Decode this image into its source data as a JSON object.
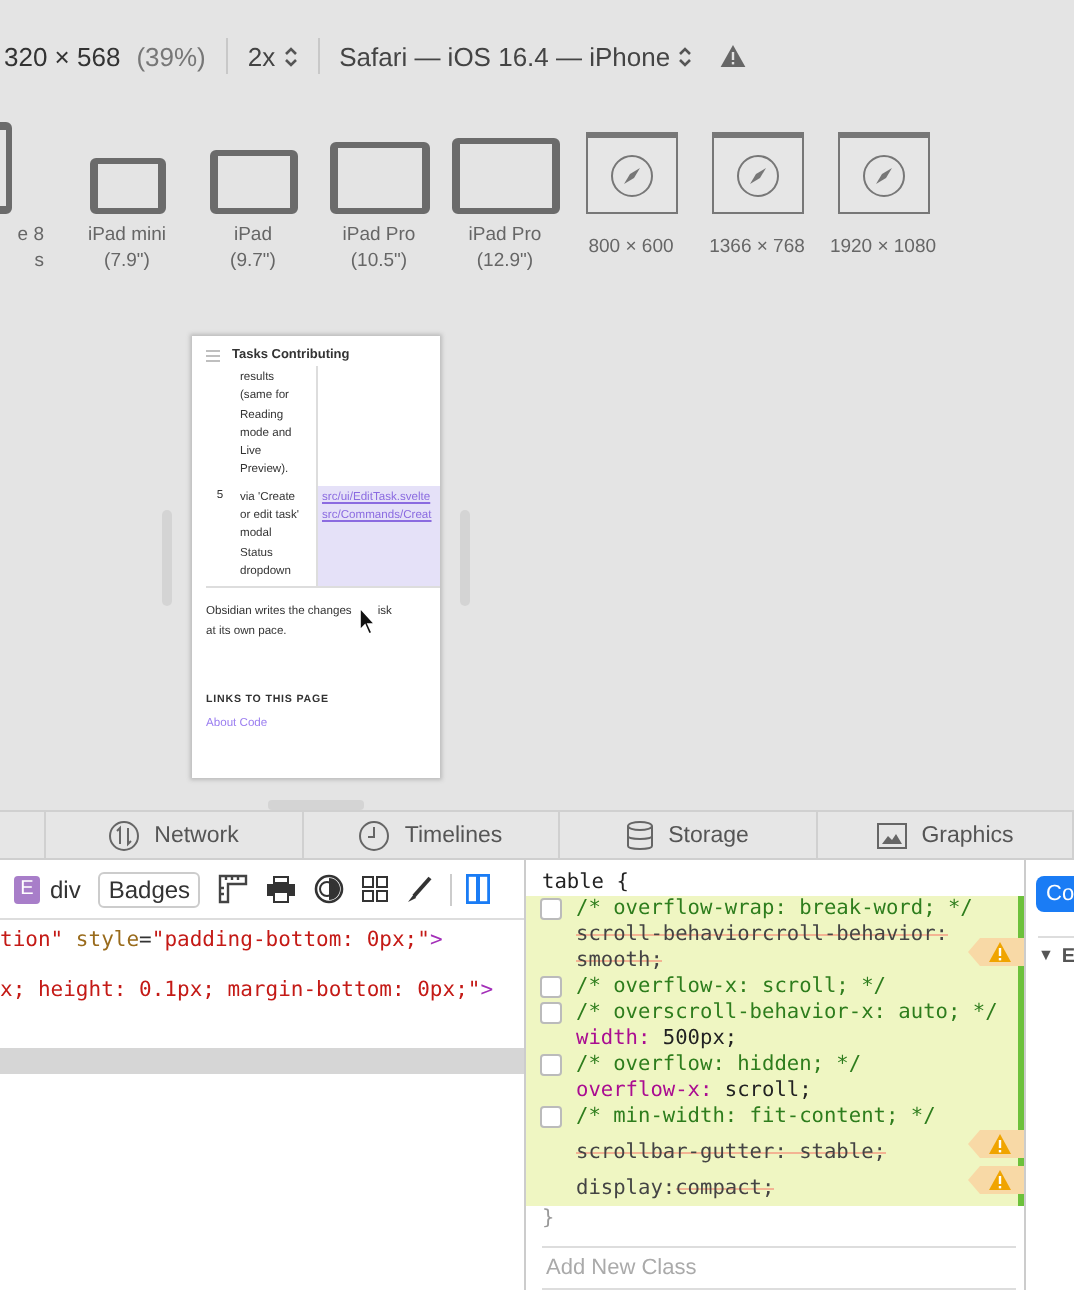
{
  "toolbar": {
    "dimensions": "320 × 568",
    "zoom": "(39%)",
    "scale": "2x",
    "browser": "Safari — iOS 16.4 — iPhone"
  },
  "devices": [
    {
      "kind": "phone",
      "label": [
        "e 8",
        "s"
      ]
    },
    {
      "kind": "ipad-mini",
      "label": [
        "iPad mini",
        "(7.9\")"
      ]
    },
    {
      "kind": "ipad",
      "label": [
        "iPad",
        "(9.7\")"
      ]
    },
    {
      "kind": "ipad-pro-10",
      "label": [
        "iPad Pro",
        "(10.5\")"
      ]
    },
    {
      "kind": "ipad-pro-12",
      "label": [
        "iPad Pro",
        "(12.9\")"
      ]
    },
    {
      "kind": "window",
      "label": [
        "800 × 600"
      ]
    },
    {
      "kind": "window",
      "label": [
        "1366 × 768"
      ]
    },
    {
      "kind": "window",
      "label": [
        "1920 × 1080"
      ]
    }
  ],
  "preview": {
    "title": "Tasks Contributing",
    "rows": [
      {
        "number": "",
        "lines": [
          "results",
          "(same for",
          "Reading",
          "mode and",
          "Live",
          "Preview)."
        ],
        "links": [],
        "highlighted": false
      },
      {
        "number": "5",
        "lines": [
          "via 'Create",
          "or edit task'",
          "modal",
          "Status",
          "dropdown"
        ],
        "links": [
          "src/ui/EditTask.svelte",
          "src/Commands/Creat"
        ],
        "highlighted": true
      }
    ],
    "paragraph": [
      "Obsidian writes the changes",
      "isk",
      "at its own pace."
    ],
    "links_heading": "LINKS TO THIS PAGE",
    "links": [
      "About Code"
    ]
  },
  "tabs": [
    {
      "label": "Network",
      "kind": "network",
      "selected": false
    },
    {
      "label": "Timelines",
      "kind": "timelines",
      "selected": false
    },
    {
      "label": "Storage",
      "kind": "storage",
      "selected": false
    },
    {
      "label": "Graphics",
      "kind": "graphics",
      "selected": false
    }
  ],
  "dom": {
    "element_badge": "E",
    "element": "div",
    "badges_button": "Badges",
    "lines": [
      [
        {
          "kind": "value",
          "text": "tion\""
        },
        {
          "kind": "name",
          "text": " style"
        },
        {
          "kind": "plain",
          "text": "="
        },
        {
          "kind": "value",
          "text": "\"padding-bottom: 0px;\""
        },
        {
          "kind": "tag",
          "text": ">"
        }
      ],
      [
        {
          "kind": "value",
          "text": "x; height: 0.1px; margin-bottom: 0px;\""
        },
        {
          "kind": "tag",
          "text": ">"
        }
      ]
    ]
  },
  "styles": {
    "selector": "table {",
    "declarations": [
      {
        "kind": "comment",
        "text": "/* overflow-wrap: break-word; */",
        "checked": false
      },
      {
        "kind": "invalid",
        "name": "scroll-behaviorcroll-behavior:",
        "value": "smooth;",
        "warning": true
      },
      {
        "kind": "comment",
        "text": "/* overflow-x: scroll; */",
        "checked": false
      },
      {
        "kind": "comment",
        "text": "/* overscroll-behavior-x: auto; */",
        "checked": false
      },
      {
        "kind": "property",
        "name": "width:",
        "value": "500px;"
      },
      {
        "kind": "comment",
        "text": "/* overflow: hidden; */",
        "checked": false
      },
      {
        "kind": "property",
        "name": "overflow-x:",
        "value": "scroll;"
      },
      {
        "kind": "comment",
        "text": "/* min-width: fit-content; */",
        "checked": false
      },
      {
        "kind": "invalid",
        "name": "scrollbar-gutter:",
        "value": "stable;",
        "warning": true
      },
      {
        "kind": "invalid-value",
        "name": "display:",
        "value": "compact;",
        "warning": true
      }
    ],
    "closing": "}",
    "add_class_placeholder": "Add New Class"
  },
  "sidebar": {
    "button": "Co",
    "toggle": "▼",
    "section": "E"
  }
}
